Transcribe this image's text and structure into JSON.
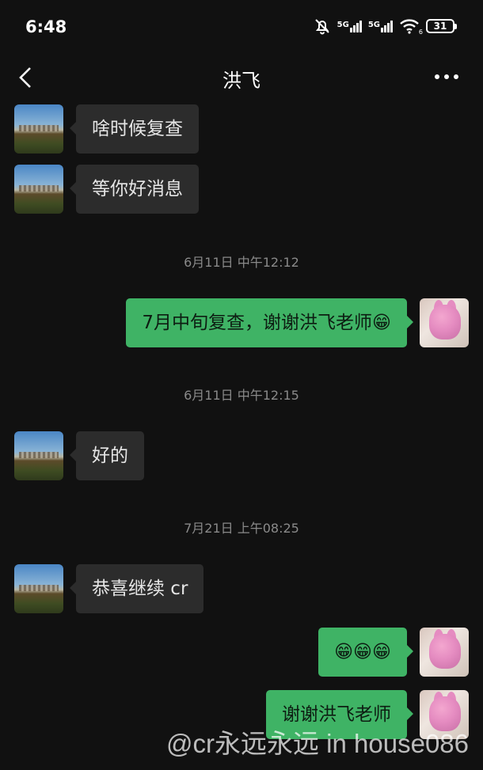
{
  "status_bar": {
    "time": "6:48",
    "network_label_1": "5G",
    "network_label_2": "5G",
    "wifi_badge": "6",
    "battery": "31",
    "icons": [
      "bell-muted-icon",
      "signal-5g-icon",
      "signal-5g-icon",
      "wifi-icon",
      "battery-icon"
    ]
  },
  "header": {
    "title": "洪飞",
    "back_icon": "chevron-left-icon",
    "more_icon": "more-dots-icon"
  },
  "messages": [
    {
      "type": "received",
      "text": "啥时候复查"
    },
    {
      "type": "received",
      "text": "等你好消息"
    },
    {
      "type": "timestamp",
      "text": "6月11日 中午12:12"
    },
    {
      "type": "sent",
      "text": "7月中旬复查，谢谢洪飞老师😁"
    },
    {
      "type": "timestamp",
      "text": "6月11日 中午12:15"
    },
    {
      "type": "received",
      "text": "好的"
    },
    {
      "type": "timestamp",
      "text": "7月21日 上午08:25"
    },
    {
      "type": "received",
      "text": "恭喜继续 cr"
    },
    {
      "type": "sent",
      "text": "😁😁😁"
    },
    {
      "type": "sent",
      "text": "谢谢洪飞老师"
    }
  ],
  "watermark": "@cr永远永远 in house086",
  "colors": {
    "background": "#111111",
    "received_bubble": "#2c2c2c",
    "sent_bubble": "#3fb365",
    "timestamp_text": "#8a8a8a"
  }
}
